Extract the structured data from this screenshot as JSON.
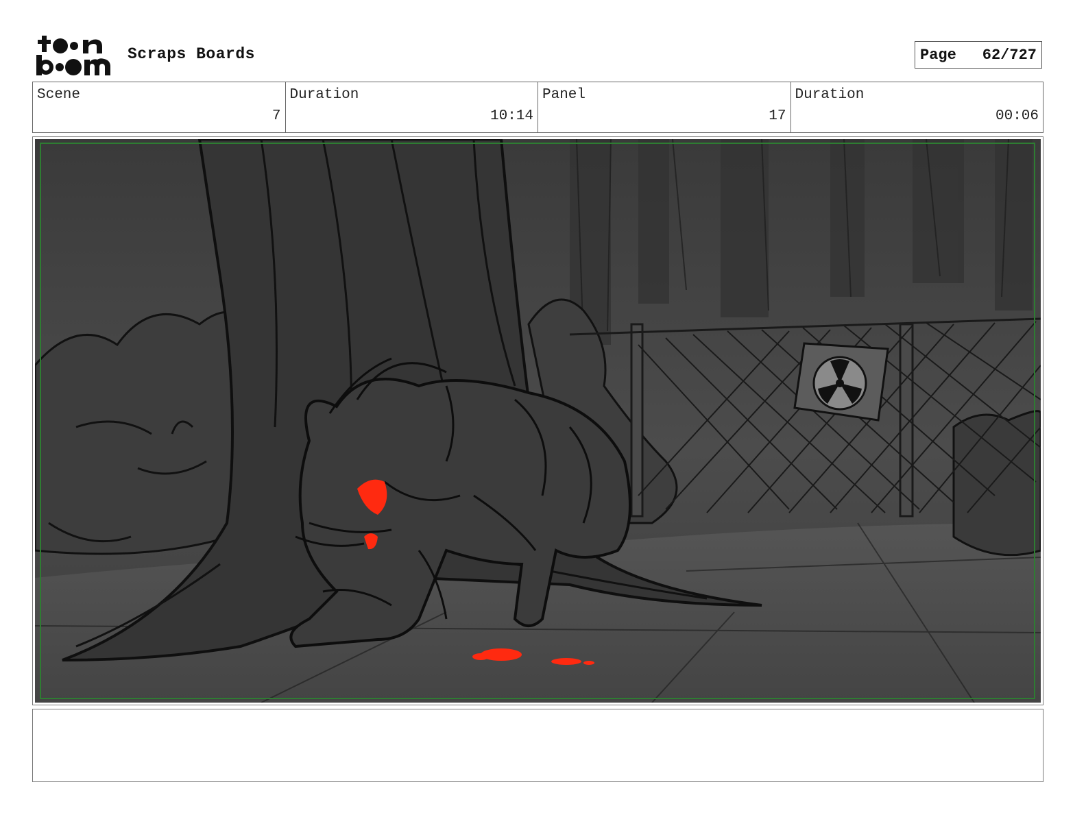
{
  "header": {
    "logo_text": "toon boom",
    "project_title": "Scraps Boards",
    "page_label": "Page",
    "page_value": "62/727"
  },
  "info": [
    {
      "label": "Scene",
      "value": "7"
    },
    {
      "label": "Duration",
      "value": "10:14"
    },
    {
      "label": "Panel",
      "value": "17"
    },
    {
      "label": "Duration",
      "value": "00:06"
    }
  ],
  "panel": {
    "accent_color": "#ff2a10",
    "safe_frame_color": "#2e7d32",
    "icons": [
      "radiation-sign-icon"
    ]
  },
  "notes": ""
}
